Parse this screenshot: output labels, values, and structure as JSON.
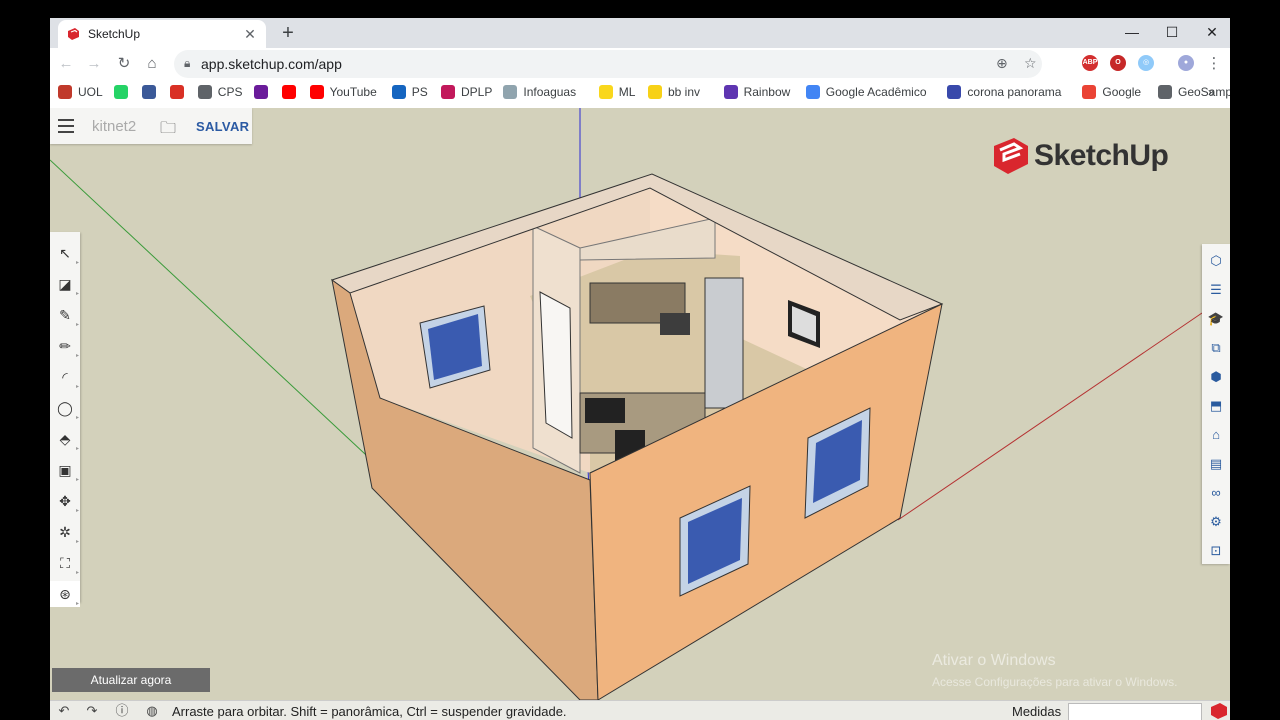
{
  "browser": {
    "tab_title": "SketchUp",
    "new_tab_label": "+",
    "window_controls": {
      "minimize": "—",
      "maximize": "☐",
      "close": "✕"
    },
    "url": "app.sketchup.com/app",
    "nav": {
      "back": "←",
      "forward": "→",
      "reload": "↻",
      "home": "⌂"
    },
    "bookmarks": [
      {
        "label": "UOL",
        "icon": "uol-icon",
        "color": "#c0392b"
      },
      {
        "label": "",
        "icon": "whatsapp-icon",
        "color": "#25d366"
      },
      {
        "label": "",
        "icon": "facebook-icon",
        "color": "#3b5998"
      },
      {
        "label": "",
        "icon": "gmail-icon",
        "color": "#d93025"
      },
      {
        "label": "CPS",
        "icon": "globe-icon",
        "color": "#5f6368"
      },
      {
        "label": "",
        "icon": "mail-icon",
        "color": "#6a1b9a"
      },
      {
        "label": "",
        "icon": "youtube-icon",
        "color": "#ff0000"
      },
      {
        "label": "YouTube",
        "icon": "youtube-icon",
        "color": "#ff0000"
      },
      {
        "label": "PS",
        "icon": "ps-icon",
        "color": "#1565c0"
      },
      {
        "label": "DPLP",
        "icon": "dplp-icon",
        "color": "#c2185b"
      },
      {
        "label": "Infoaguas",
        "icon": "doc-icon",
        "color": "#90a4ae"
      },
      {
        "label": "ML",
        "icon": "ml-icon",
        "color": "#f9d71c"
      },
      {
        "label": "bb inv",
        "icon": "bb-icon",
        "color": "#f7d117"
      },
      {
        "label": "Rainbow",
        "icon": "rainbow-icon",
        "color": "#5e35b1"
      },
      {
        "label": "Google Acadêmico",
        "icon": "scholar-icon",
        "color": "#4285f4"
      },
      {
        "label": "corona panorama",
        "icon": "shield-icon",
        "color": "#3949ab"
      },
      {
        "label": "Google",
        "icon": "google-icon",
        "color": "#ea4335"
      },
      {
        "label": "GeoSampa",
        "icon": "globe-icon",
        "color": "#5f6368"
      }
    ],
    "more_bookmarks": "»"
  },
  "app": {
    "file_name": "kitnet2",
    "save_label": "SALVAR",
    "logo_text": "SketchUp",
    "update_label": "Atualizar agora",
    "left_tools": [
      {
        "name": "select-tool-icon",
        "glyph": "↖"
      },
      {
        "name": "eraser-tool-icon",
        "glyph": "◪"
      },
      {
        "name": "paint-tool-icon",
        "glyph": "✎"
      },
      {
        "name": "line-tool-icon",
        "glyph": "✏"
      },
      {
        "name": "arc-tool-icon",
        "glyph": "◜"
      },
      {
        "name": "circle-tool-icon",
        "glyph": "◯"
      },
      {
        "name": "push-pull-tool-icon",
        "glyph": "⬘"
      },
      {
        "name": "offset-tool-icon",
        "glyph": "▣"
      },
      {
        "name": "move-tool-icon",
        "glyph": "✥"
      },
      {
        "name": "axes-tool-icon",
        "glyph": "✲"
      },
      {
        "name": "walk-tool-icon",
        "glyph": "⛶"
      },
      {
        "name": "orbit-tool-icon",
        "glyph": "⊛"
      }
    ],
    "right_tools": [
      {
        "name": "entity-info-icon",
        "glyph": "⬡"
      },
      {
        "name": "layers-icon",
        "glyph": "☰"
      },
      {
        "name": "instructor-icon",
        "glyph": "🎓"
      },
      {
        "name": "components-icon",
        "glyph": "⧉"
      },
      {
        "name": "materials-icon",
        "glyph": "⬢"
      },
      {
        "name": "styles-icon",
        "glyph": "⬒"
      },
      {
        "name": "tags-icon",
        "glyph": "⌂"
      },
      {
        "name": "scenes-icon",
        "glyph": "▤"
      },
      {
        "name": "display-icon",
        "glyph": "∞"
      },
      {
        "name": "solar-icon",
        "glyph": "⚙"
      },
      {
        "name": "report-icon",
        "glyph": "⊡"
      }
    ],
    "windows_watermark": {
      "line1": "Ativar o Windows",
      "line2": "Acesse Configurações para ativar o Windows."
    },
    "status": {
      "hint": "Arraste para orbitar. Shift = panorâmica, Ctrl = suspender gravidade.",
      "measure_label": "Medidas",
      "measure_value": ""
    },
    "colors": {
      "brand": "#d9262e",
      "save": "#2b5aa3",
      "sky": "#d3d1bb"
    }
  }
}
